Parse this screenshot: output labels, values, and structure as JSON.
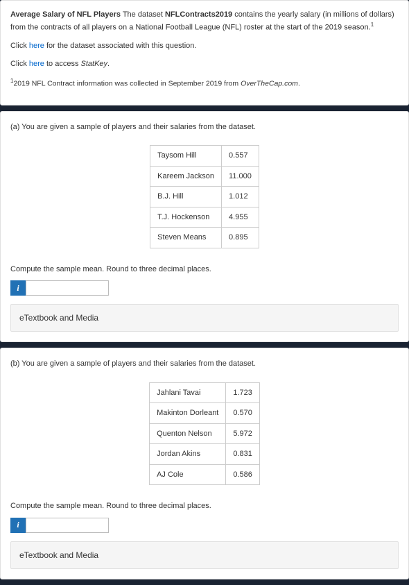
{
  "intro": {
    "title_bold": "Average Salary of NFL Players",
    "dataset_label": "NFLContracts2019",
    "body_pre": " The dataset ",
    "body_post": " contains the yearly salary (in millions of dollars) from the contracts of all players on a National Football League (NFL) roster at the start of the 2019 season.",
    "superscript": "1",
    "click1_pre": "Click ",
    "click1_link": "here",
    "click1_post": " for the dataset associated with this question.",
    "click2_pre": "Click ",
    "click2_link": "here",
    "click2_post_pre": " to access ",
    "click2_post_italic": "StatKey",
    "click2_post_end": ".",
    "footnote_sup": "1",
    "footnote_pre": "2019 NFL Contract information was collected in September 2019 from ",
    "footnote_italic": "OverTheCap.com",
    "footnote_end": "."
  },
  "partA": {
    "prompt": "(a) You are given a sample of players and their salaries from the dataset.",
    "rows": [
      {
        "name": "Taysom Hill",
        "val": "0.557"
      },
      {
        "name": "Kareem Jackson",
        "val": "11.000"
      },
      {
        "name": "B.J. Hill",
        "val": "1.012"
      },
      {
        "name": "T.J. Hockenson",
        "val": "4.955"
      },
      {
        "name": "Steven Means",
        "val": "0.895"
      }
    ],
    "compute": "Compute the sample mean. Round to three decimal places.",
    "info": "i",
    "etextbook": "eTextbook and Media"
  },
  "partB": {
    "prompt": "(b) You are given a sample of players and their salaries from the dataset.",
    "rows": [
      {
        "name": "Jahlani Tavai",
        "val": "1.723"
      },
      {
        "name": "Makinton Dorleant",
        "val": "0.570"
      },
      {
        "name": "Quenton Nelson",
        "val": "5.972"
      },
      {
        "name": "Jordan Akins",
        "val": "0.831"
      },
      {
        "name": "AJ Cole",
        "val": "0.586"
      }
    ],
    "compute": "Compute the sample mean. Round to three decimal places.",
    "info": "i",
    "etextbook": "eTextbook and Media"
  }
}
